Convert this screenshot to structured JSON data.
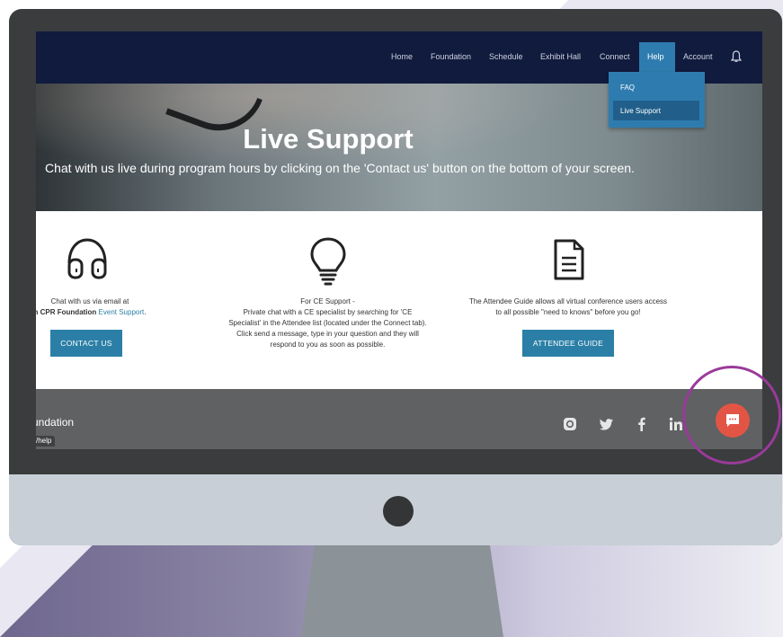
{
  "nav": {
    "items": [
      "Home",
      "Foundation",
      "Schedule",
      "Exhibit Hall",
      "Connect"
    ],
    "help": "Help",
    "account": "Account",
    "dropdown": {
      "faq": "FAQ",
      "live_support": "Live Support"
    }
  },
  "hero": {
    "title": "Live Support",
    "subtitle": "Chat with us live during program hours by clicking on the 'Contact us' button on the bottom of your screen."
  },
  "columns": {
    "email": {
      "line1": "Chat with us via email at",
      "line2_prefix": "n CPR Foundation",
      "line2_link": "Event Support",
      "line2_suffix": ".",
      "button": "CONTACT US"
    },
    "ce": {
      "lines": [
        "For CE Support -",
        "Private chat with a CE specialist by searching for 'CE",
        "Specialist' in the Attendee list (located under the Connect tab).",
        "Click send a message, type in your question and they will",
        "respond to you as soon as possible."
      ]
    },
    "guide": {
      "line1": "The Attendee Guide allows all virtual conference users access",
      "line2": "to all possible \"need to knows\" before you go!",
      "button": "ATTENDEE GUIDE"
    }
  },
  "footer": {
    "brand": "undation",
    "url": "/help"
  },
  "colors": {
    "nav_bg": "#111b3e",
    "accent": "#2e7caf",
    "button": "#2b7fa6",
    "chat_button": "#e25544",
    "highlight_ring": "#9a3a9a"
  },
  "icons": [
    "headset-icon",
    "lightbulb-icon",
    "document-icon",
    "bell-icon",
    "instagram-icon",
    "twitter-icon",
    "facebook-icon",
    "linkedin-icon",
    "chat-icon"
  ]
}
